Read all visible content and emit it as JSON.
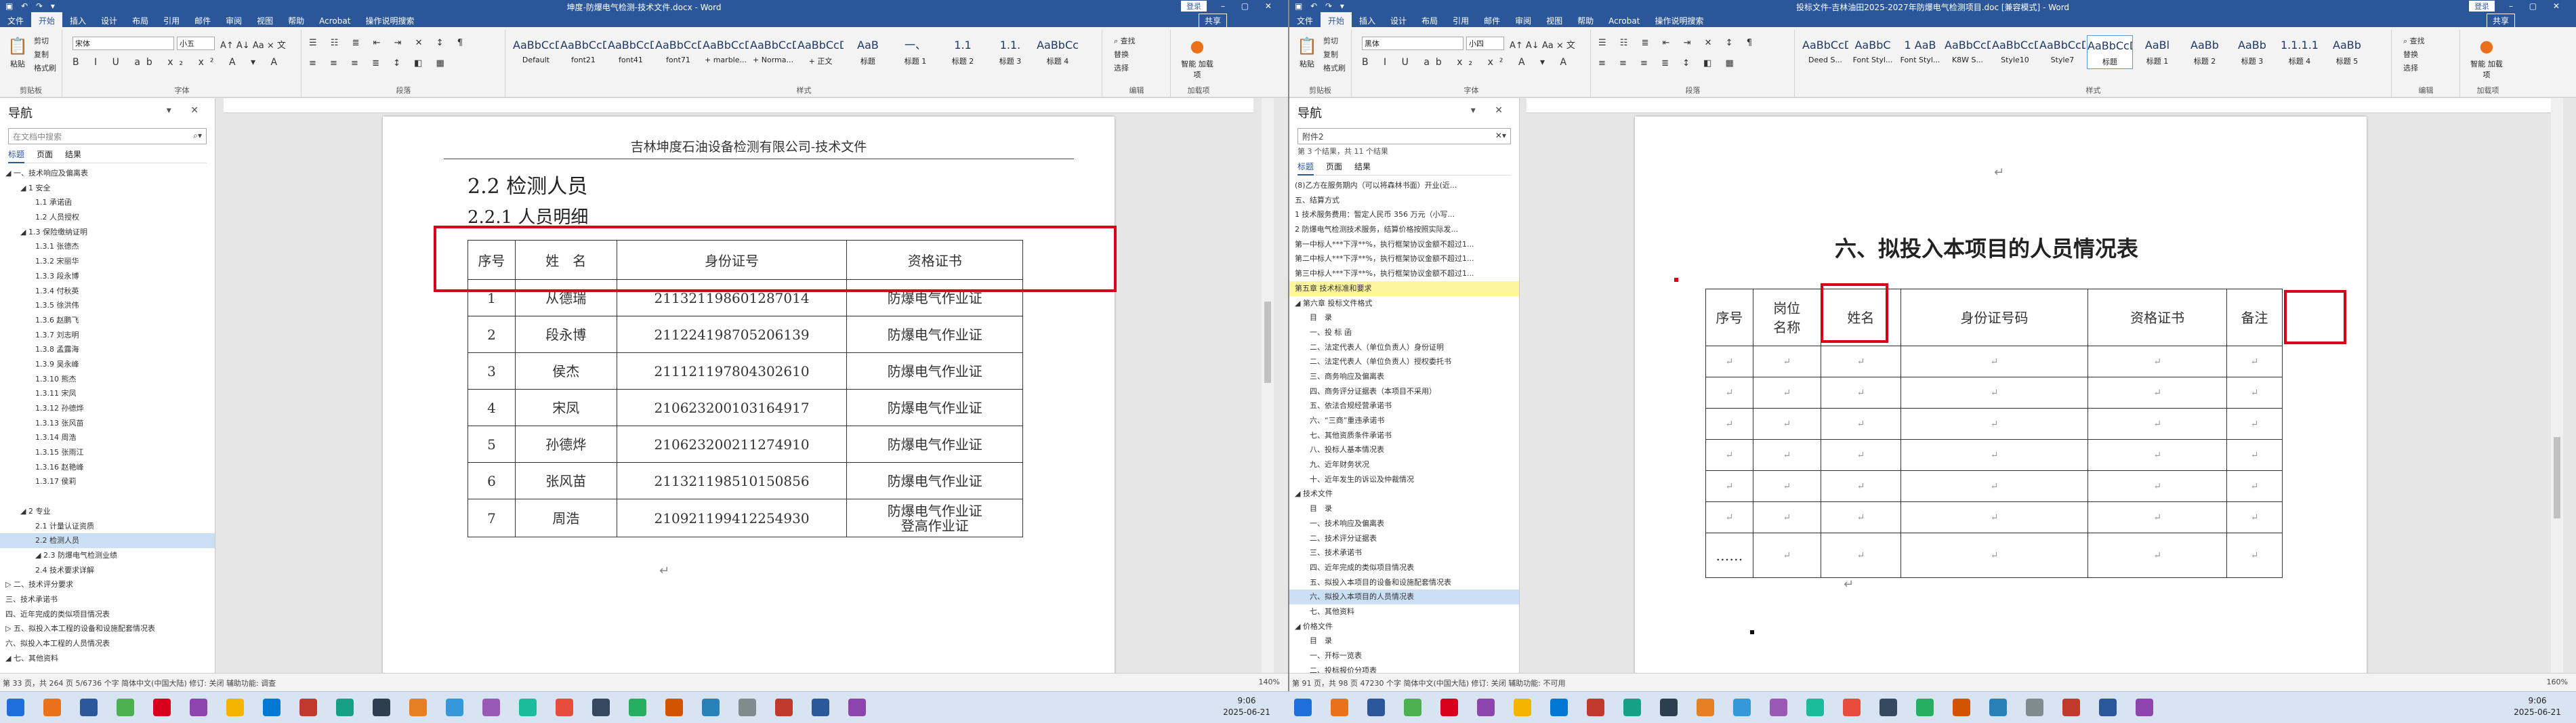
{
  "left": {
    "title": "坤度-防爆电气检测-技术文件.docx - Word",
    "login": "登录",
    "share": "共享",
    "tabs": [
      "文件",
      "开始",
      "插入",
      "设计",
      "布局",
      "引用",
      "邮件",
      "审阅",
      "视图",
      "帮助",
      "Acrobat",
      "操作说明搜索"
    ],
    "clipboard": {
      "paste": "粘贴",
      "cut": "剪切",
      "copy": "复制",
      "painter": "格式刷",
      "label": "剪贴板"
    },
    "font": {
      "name": "宋体",
      "size": "小五",
      "label": "字体"
    },
    "paragraph_label": "段落",
    "styles": [
      {
        "p": "AaBbCcDdE",
        "n": "Default"
      },
      {
        "p": "AaBbCcDd",
        "n": "font21"
      },
      {
        "p": "AaBbCcDd",
        "n": "font41"
      },
      {
        "p": "AaBbCcDd",
        "n": "font71"
      },
      {
        "p": "AaBbCcDd",
        "n": "+ marble..."
      },
      {
        "p": "AaBbCcDd",
        "n": "+ Norma..."
      },
      {
        "p": "AaBbCcDc",
        "n": "+ 正文"
      },
      {
        "p": "AaB",
        "n": "标题"
      },
      {
        "p": "一、",
        "n": "标题 1"
      },
      {
        "p": "1.1",
        "n": "标题 2"
      },
      {
        "p": "1.1.",
        "n": "标题 3"
      },
      {
        "p": "AaBbCc",
        "n": "标题 4"
      }
    ],
    "styles_label": "样式",
    "edit": {
      "find": "查找",
      "replace": "替换",
      "select": "选择",
      "label": "编辑"
    },
    "addin": {
      "label": "加载项",
      "btn": "智能\n加载项"
    },
    "nav": {
      "title": "导航",
      "search": "在文档中搜索",
      "tabs": [
        "标题",
        "页面",
        "结果"
      ],
      "items": [
        {
          "i": 0,
          "t": "◢ 一、技术响应及偏离表"
        },
        {
          "i": 1,
          "t": "◢ 1 安全"
        },
        {
          "i": 2,
          "t": "1.1 承诺函"
        },
        {
          "i": 2,
          "t": "1.2 人员授权"
        },
        {
          "i": 1,
          "t": "◢ 1.3 保险缴纳证明"
        },
        {
          "i": 2,
          "t": "1.3.1 张德杰"
        },
        {
          "i": 2,
          "t": "1.3.2 宋丽华"
        },
        {
          "i": 2,
          "t": "1.3.3 段永博"
        },
        {
          "i": 2,
          "t": "1.3.4 付秋英"
        },
        {
          "i": 2,
          "t": "1.3.5 徐洪伟"
        },
        {
          "i": 2,
          "t": "1.3.6 赵鹏飞"
        },
        {
          "i": 2,
          "t": "1.3.7 刘志明"
        },
        {
          "i": 2,
          "t": "1.3.8 孟露海"
        },
        {
          "i": 2,
          "t": "1.3.9 吴永峰"
        },
        {
          "i": 2,
          "t": "1.3.10 熊杰"
        },
        {
          "i": 2,
          "t": "1.3.11 宋凤"
        },
        {
          "i": 2,
          "t": "1.3.12 孙德烨"
        },
        {
          "i": 2,
          "t": "1.3.13 张风苗"
        },
        {
          "i": 2,
          "t": "1.3.14 周浩"
        },
        {
          "i": 2,
          "t": "1.3.15 张雨江"
        },
        {
          "i": 2,
          "t": "1.3.16 赵艳峰"
        },
        {
          "i": 2,
          "t": "1.3.17 侯莉"
        },
        {
          "i": 0,
          "t": ""
        },
        {
          "i": 1,
          "t": "◢ 2 专业"
        },
        {
          "i": 2,
          "t": "2.1 计量认证资质"
        },
        {
          "i": 2,
          "t": "2.2 检测人员",
          "sel": true
        },
        {
          "i": 2,
          "t": "◢ 2.3 防爆电气检测业绩"
        },
        {
          "i": 2,
          "t": "2.4 技术要求详解"
        },
        {
          "i": 0,
          "t": "▷ 二、技术评分要求"
        },
        {
          "i": 0,
          "t": "三、技术承诺书"
        },
        {
          "i": 0,
          "t": "四、近年完成的类似项目情况表"
        },
        {
          "i": 0,
          "t": "▷ 五、拟投入本工程的设备和设施配套情况表"
        },
        {
          "i": 0,
          "t": "六、拟投入本工程的人员情况表"
        },
        {
          "i": 0,
          "t": "◢ 七、其他资料"
        }
      ]
    },
    "header": "吉林坤度石油设备检测有限公司-技术文件",
    "h1": "2.2 检测人员",
    "h2": "2.2.1 人员明细",
    "table": {
      "cols": [
        "序号",
        "姓　名",
        "身份证号",
        "资格证书"
      ],
      "rows": [
        [
          "1",
          "从德瑞",
          "211321198601287014",
          "防爆电气作业证"
        ],
        [
          "2",
          "段永博",
          "211224198705206139",
          "防爆电气作业证"
        ],
        [
          "3",
          "侯杰",
          "211121197804302610",
          "防爆电气作业证"
        ],
        [
          "4",
          "宋凤",
          "210623200103164917",
          "防爆电气作业证"
        ],
        [
          "5",
          "孙德烨",
          "210623200211274910",
          "防爆电气作业证"
        ],
        [
          "6",
          "张风苗",
          "211321198510150856",
          "防爆电气作业证"
        ],
        [
          "7",
          "周浩",
          "210921199412254930",
          "防爆电气作业证\n登高作业证"
        ]
      ]
    },
    "status": {
      "left": "第 33 页，共 264 页    5/6736 个字    简体中文(中国大陆)    修订: 关闭    辅助功能: 调查",
      "zoom": "140%"
    }
  },
  "right": {
    "title": "投标文件-吉林油田2025-2027年防爆电气检测项目.doc [兼容模式] - Word",
    "login": "登录",
    "share": "共享",
    "tabs": [
      "文件",
      "开始",
      "插入",
      "设计",
      "布局",
      "引用",
      "邮件",
      "审阅",
      "视图",
      "帮助",
      "Acrobat",
      "操作说明搜索"
    ],
    "clipboard": {
      "paste": "粘贴",
      "cut": "剪切",
      "copy": "复制",
      "painter": "格式刷",
      "label": "剪贴板"
    },
    "font": {
      "name": "黑体",
      "size": "小四",
      "label": "字体"
    },
    "paragraph_label": "段落",
    "styles": [
      {
        "p": "AaBbCcDc",
        "n": "Deed S..."
      },
      {
        "p": "AaBbC",
        "n": "Font Styl..."
      },
      {
        "p": "1 AaB",
        "n": "Font Styl..."
      },
      {
        "p": "AaBbCcD",
        "n": "K8W S..."
      },
      {
        "p": "AaBbCcDc",
        "n": "Style10"
      },
      {
        "p": "AaBbCcDc",
        "n": "Style7"
      },
      {
        "p": "AaBbCcDc",
        "n": "标题",
        "sel": true
      },
      {
        "p": "AaBl",
        "n": "标题 1"
      },
      {
        "p": "AaBb",
        "n": "标题 2"
      },
      {
        "p": "AaBb",
        "n": "标题 3"
      },
      {
        "p": "1.1.1.1",
        "n": "标题 4"
      },
      {
        "p": "AaBb",
        "n": "标题 5"
      }
    ],
    "styles_label": "样式",
    "edit": {
      "find": "查找",
      "replace": "替换",
      "select": "选择",
      "label": "编辑"
    },
    "addin": {
      "label": "加载项",
      "btn": "智能\n加载项"
    },
    "nav": {
      "title": "导航",
      "search": "附件2",
      "result_count": "第 3 个结果，共 11 个结果",
      "tabs": [
        "标题",
        "页面",
        "结果"
      ],
      "items": [
        {
          "i": 0,
          "t": "(8)乙方在服务期内（可以将森林书面）开业(近..."
        },
        {
          "i": 0,
          "t": "五、结算方式"
        },
        {
          "i": 0,
          "t": "1 技术服务费用：暂定人民币 356 万元（小写..."
        },
        {
          "i": 0,
          "t": "2 防爆电气检测技术服务，结算价格按照实际发..."
        },
        {
          "i": 0,
          "t": "第一中标人***下浮**%，执行框架协议金额不超过1..."
        },
        {
          "i": 0,
          "t": "第二中标人***下浮**%，执行框架协议金额不超过1..."
        },
        {
          "i": 0,
          "t": "第三中标人***下浮**%，执行框架协议金额不超过1..."
        },
        {
          "i": 0,
          "t": "第五章 技术标准和要求",
          "hl": true
        },
        {
          "i": 0,
          "t": "◢ 第六章 投标文件格式"
        },
        {
          "i": 1,
          "t": "目　录"
        },
        {
          "i": 1,
          "t": "一、投 标 函"
        },
        {
          "i": 1,
          "t": "二、法定代表人（单位负责人）身份证明"
        },
        {
          "i": 1,
          "t": "二、法定代表人（单位负责人）授权委托书"
        },
        {
          "i": 1,
          "t": "三、商务响应及偏离表"
        },
        {
          "i": 1,
          "t": "四、商务评分证据表（本项目不采用）"
        },
        {
          "i": 1,
          "t": "五、依法合规经营承诺书"
        },
        {
          "i": 1,
          "t": "六、“三商”重违承诺书"
        },
        {
          "i": 1,
          "t": "七、其他资质条件承诺书"
        },
        {
          "i": 1,
          "t": "八、投标人基本情况表"
        },
        {
          "i": 1,
          "t": "九、近年财务状况"
        },
        {
          "i": 1,
          "t": "十、近年发生的诉讼及仲裁情况"
        },
        {
          "i": 0,
          "t": "◢ 技术文件"
        },
        {
          "i": 1,
          "t": "目　录"
        },
        {
          "i": 1,
          "t": "一、技术响应及偏离表"
        },
        {
          "i": 1,
          "t": "二、技术评分证据表"
        },
        {
          "i": 1,
          "t": "三、技术承诺书"
        },
        {
          "i": 1,
          "t": "四、近年完成的类似项目情况表"
        },
        {
          "i": 1,
          "t": "五、拟投入本项目的设备和设施配套情况表"
        },
        {
          "i": 1,
          "t": "六、拟投入本项目的人员情况表",
          "sel": true
        },
        {
          "i": 1,
          "t": "七、其他资料"
        },
        {
          "i": 0,
          "t": "◢ 价格文件"
        },
        {
          "i": 1,
          "t": "目　录"
        },
        {
          "i": 1,
          "t": "一、开标一览表"
        },
        {
          "i": 1,
          "t": "二、投标报价分项表"
        }
      ]
    },
    "h1": "六、拟投入本项目的人员情况表",
    "table": {
      "cols": [
        "序号",
        "岗位\n名称",
        "姓名",
        "身份证号码",
        "资格证书",
        "备注"
      ],
      "row_count": 6,
      "last_row_first": "……"
    },
    "status": {
      "left": "第 91 页，共 98 页    47230 个字    简体中文(中国大陆)    修订: 关闭    辅助功能: 不可用",
      "zoom": "160%"
    }
  },
  "taskbar": {
    "clock_left": {
      "time": "9:06",
      "date": "2025-06-21"
    },
    "clock_right": {
      "time": "9:06",
      "date": "2025-06-21"
    }
  },
  "colors": {
    "word_blue": "#2b579a",
    "annotation_red": "#d9001b"
  }
}
